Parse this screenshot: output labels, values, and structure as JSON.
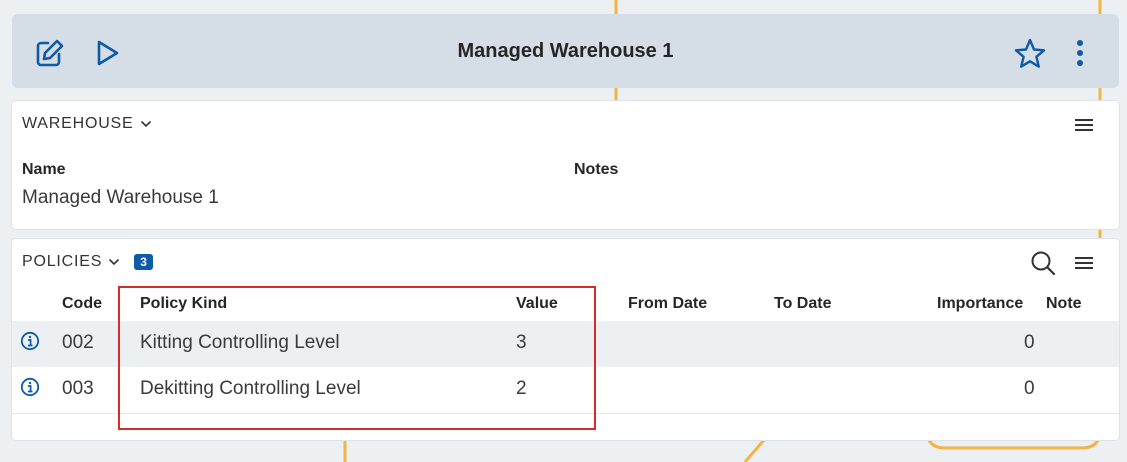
{
  "header": {
    "title": "Managed Warehouse 1",
    "icons": [
      "edit-icon",
      "play-icon",
      "star-icon",
      "more-vertical-icon"
    ]
  },
  "warehouse_section": {
    "heading": "WAREHOUSE",
    "name_label": "Name",
    "name_value": "Managed Warehouse 1",
    "notes_label": "Notes"
  },
  "policies_section": {
    "heading": "POLICIES",
    "count": "3",
    "columns": {
      "code": "Code",
      "policy_kind": "Policy Kind",
      "value": "Value",
      "from_date": "From Date",
      "to_date": "To Date",
      "importance": "Importance",
      "note": "Note"
    },
    "rows": [
      {
        "code": "002",
        "policy_kind": "Kitting Controlling Level",
        "value": "3",
        "importance": "0"
      },
      {
        "code": "003",
        "policy_kind": "Dekitting Controlling Level",
        "value": "2",
        "importance": "0"
      }
    ]
  },
  "colors": {
    "accent": "#0d5aa7",
    "header_bg": "#d5dde6",
    "highlight": "#d52b2b",
    "decor": "#f5a623"
  }
}
